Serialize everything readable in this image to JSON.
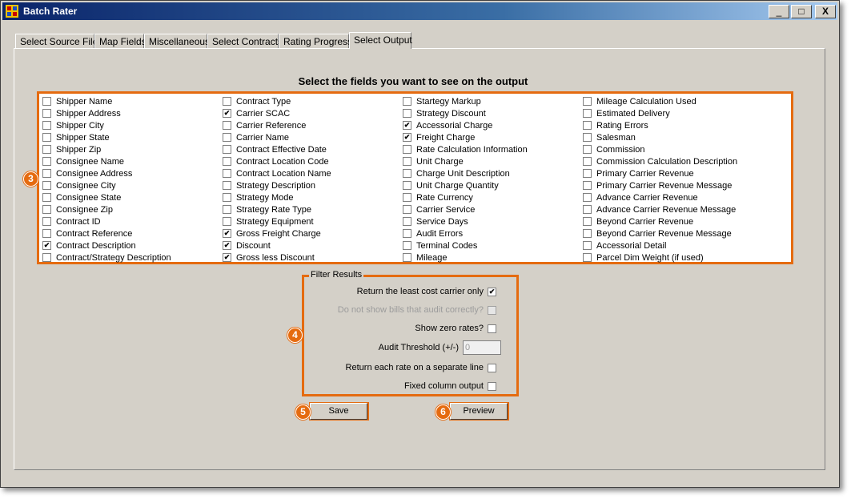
{
  "window": {
    "title": "Batch Rater",
    "minimize": "_",
    "maximize": "□",
    "close": "X"
  },
  "tabs": [
    "Select Source File",
    "Map Fields",
    "Miscellaneous",
    "Select Contracts",
    "Rating Progress",
    "Select Output"
  ],
  "active_tab": "Select Output",
  "heading": "Select the fields you want to see on the output",
  "fields": {
    "col1": [
      {
        "label": "Shipper Name",
        "checked": false
      },
      {
        "label": "Shipper Address",
        "checked": false
      },
      {
        "label": "Shipper City",
        "checked": false
      },
      {
        "label": "Shipper State",
        "checked": false
      },
      {
        "label": "Shipper Zip",
        "checked": false
      },
      {
        "label": "Consignee Name",
        "checked": false
      },
      {
        "label": "Consignee Address",
        "checked": false
      },
      {
        "label": "Consignee City",
        "checked": false
      },
      {
        "label": "Consignee State",
        "checked": false
      },
      {
        "label": "Consignee Zip",
        "checked": false
      },
      {
        "label": "Contract ID",
        "checked": false
      },
      {
        "label": "Contract Reference",
        "checked": false
      },
      {
        "label": "Contract Description",
        "checked": true
      },
      {
        "label": "Contract/Strategy Description",
        "checked": false
      }
    ],
    "col2": [
      {
        "label": "Contract Type",
        "checked": false
      },
      {
        "label": "Carrier SCAC",
        "checked": true
      },
      {
        "label": "Carrier Reference",
        "checked": false
      },
      {
        "label": "Carrier Name",
        "checked": false
      },
      {
        "label": "Contract Effective Date",
        "checked": false
      },
      {
        "label": "Contract Location Code",
        "checked": false
      },
      {
        "label": "Contract Location Name",
        "checked": false
      },
      {
        "label": "Strategy Description",
        "checked": false
      },
      {
        "label": "Strategy Mode",
        "checked": false
      },
      {
        "label": "Strategy Rate Type",
        "checked": false
      },
      {
        "label": "Strategy Equipment",
        "checked": false
      },
      {
        "label": "Gross Freight Charge",
        "checked": true
      },
      {
        "label": "Discount",
        "checked": true
      },
      {
        "label": "Gross less Discount",
        "checked": true
      }
    ],
    "col3": [
      {
        "label": "Startegy Markup",
        "checked": false
      },
      {
        "label": "Strategy Discount",
        "checked": false
      },
      {
        "label": "Accessorial Charge",
        "checked": true
      },
      {
        "label": "Freight Charge",
        "checked": true
      },
      {
        "label": "Rate Calculation Information",
        "checked": false
      },
      {
        "label": "Unit Charge",
        "checked": false
      },
      {
        "label": "Charge Unit Description",
        "checked": false
      },
      {
        "label": "Unit Charge Quantity",
        "checked": false
      },
      {
        "label": "Rate Currency",
        "checked": false
      },
      {
        "label": "Carrier Service",
        "checked": false
      },
      {
        "label": "Service Days",
        "checked": false
      },
      {
        "label": "Audit Errors",
        "checked": false
      },
      {
        "label": "Terminal Codes",
        "checked": false
      },
      {
        "label": "Mileage",
        "checked": false
      }
    ],
    "col4": [
      {
        "label": "Mileage Calculation Used",
        "checked": false
      },
      {
        "label": "Estimated Delivery",
        "checked": false
      },
      {
        "label": "Rating Errors",
        "checked": false
      },
      {
        "label": "Salesman",
        "checked": false
      },
      {
        "label": "Commission",
        "checked": false
      },
      {
        "label": "Commission Calculation Description",
        "checked": false
      },
      {
        "label": "Primary Carrier Revenue",
        "checked": false
      },
      {
        "label": "Primary Carrier Revenue Message",
        "checked": false
      },
      {
        "label": "Advance Carrier Revenue",
        "checked": false
      },
      {
        "label": "Advance Carrier Revenue Message",
        "checked": false
      },
      {
        "label": "Beyond Carrier Revenue",
        "checked": false
      },
      {
        "label": "Beyond Carrier Revenue Message",
        "checked": false
      },
      {
        "label": "Accessorial Detail",
        "checked": false
      },
      {
        "label": "Parcel Dim Weight (if used)",
        "checked": false
      }
    ]
  },
  "filter": {
    "legend": "Filter Results",
    "least_cost": {
      "label": "Return the least cost carrier only",
      "checked": true
    },
    "no_audit": {
      "label": "Do not show bills that audit correctly?",
      "checked": false
    },
    "zero_rates": {
      "label": "Show zero rates?",
      "checked": false
    },
    "audit_threshold": {
      "label": "Audit Threshold (+/-)",
      "value": "0"
    },
    "separate_line": {
      "label": "Return each rate on a separate line",
      "checked": false
    },
    "fixed_column": {
      "label": "Fixed column output",
      "checked": false
    }
  },
  "buttons": {
    "save": "Save",
    "preview": "Preview"
  },
  "callouts": [
    "3",
    "4",
    "5",
    "6"
  ],
  "colors": {
    "highlight": "#e56b10",
    "window_bg": "#d4d0c8",
    "title_bar": "#0a246a"
  }
}
